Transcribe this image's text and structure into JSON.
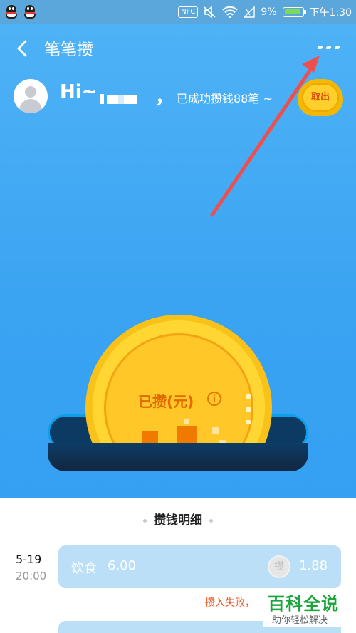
{
  "status_bar": {
    "nfc": "NFC",
    "battery_percent": "9%",
    "time": "下午1:30",
    "battery_level": 0.09,
    "icons": [
      "qq-icon",
      "qq-icon",
      "mute-icon",
      "wifi-icon",
      "signal-icon",
      "battery-icon"
    ]
  },
  "nav": {
    "back_icon": "chevron-left-icon",
    "title": "笔笔攒",
    "more_icon": "more-icon"
  },
  "user": {
    "greeting": "Hi~",
    "comma": "，",
    "success_text": "已成功攒钱88笔 ~",
    "withdraw_label": "取出"
  },
  "coin": {
    "label": "已攒(元)",
    "info_icon": "i"
  },
  "details": {
    "title": "攒钱明细",
    "records": [
      {
        "date": "5-19",
        "time": "20:00",
        "category": "饮食",
        "value": "6.00",
        "coin_icon": "攒",
        "amount": "1.88",
        "status": "攒入失败，"
      }
    ]
  },
  "watermark": {
    "main": "百科全说",
    "sub": "助你轻松解决"
  },
  "colors": {
    "hero_blue": "#3aa3f2",
    "coin_gold": "#ffd632",
    "fail_red": "#e8521f",
    "watermark_green": "#1aa53a"
  }
}
